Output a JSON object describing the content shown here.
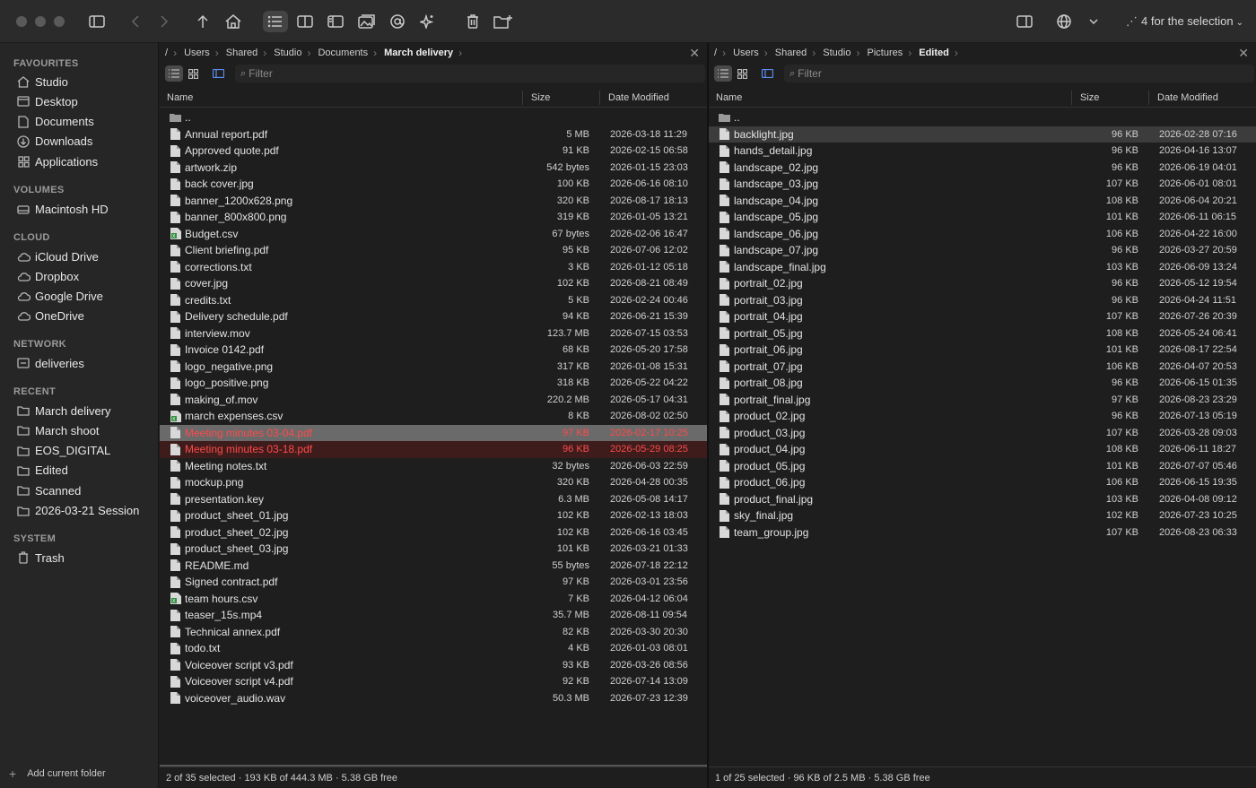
{
  "toolbar": {
    "selection_label": "4 for the selection"
  },
  "sidebar": {
    "sections": [
      {
        "title": "FAVOURITES",
        "items": [
          {
            "label": "Studio",
            "icon": "home-icon"
          },
          {
            "label": "Desktop",
            "icon": "desktop-icon"
          },
          {
            "label": "Documents",
            "icon": "document-icon"
          },
          {
            "label": "Downloads",
            "icon": "download-icon"
          },
          {
            "label": "Applications",
            "icon": "applications-icon"
          }
        ]
      },
      {
        "title": "VOLUMES",
        "items": [
          {
            "label": "Macintosh HD",
            "icon": "drive-icon"
          }
        ]
      },
      {
        "title": "CLOUD",
        "items": [
          {
            "label": "iCloud Drive",
            "icon": "cloud-icon"
          },
          {
            "label": "Dropbox",
            "icon": "cloud-icon"
          },
          {
            "label": "Google Drive",
            "icon": "cloud-icon"
          },
          {
            "label": "OneDrive",
            "icon": "cloud-icon"
          }
        ]
      },
      {
        "title": "NETWORK",
        "items": [
          {
            "label": "deliveries",
            "icon": "network-drive-icon"
          }
        ]
      },
      {
        "title": "RECENT",
        "items": [
          {
            "label": "March delivery",
            "icon": "folder-icon"
          },
          {
            "label": "March shoot",
            "icon": "folder-icon"
          },
          {
            "label": "EOS_DIGITAL",
            "icon": "folder-icon"
          },
          {
            "label": "Edited",
            "icon": "folder-icon"
          },
          {
            "label": "Scanned",
            "icon": "folder-icon"
          },
          {
            "label": "2026-03-21 Session",
            "icon": "folder-icon"
          }
        ]
      },
      {
        "title": "SYSTEM",
        "items": [
          {
            "label": "Trash",
            "icon": "trash-icon"
          }
        ]
      }
    ],
    "footer": "Add current folder"
  },
  "left_pane": {
    "breadcrumb": [
      "/",
      "Users",
      "Shared",
      "Studio",
      "Documents",
      "March delivery"
    ],
    "filter_placeholder": "Filter",
    "columns": {
      "name": "Name",
      "size": "Size",
      "date": "Date Modified"
    },
    "files": [
      {
        "name": "..",
        "size": "",
        "date": "",
        "type": "folder"
      },
      {
        "name": "Annual report.pdf",
        "size": "5 MB",
        "date": "2026-03-18 11:29",
        "type": "file"
      },
      {
        "name": "Approved quote.pdf",
        "size": "91 KB",
        "date": "2026-02-15 06:58",
        "type": "file"
      },
      {
        "name": "artwork.zip",
        "size": "542 bytes",
        "date": "2026-01-15 23:03",
        "type": "file"
      },
      {
        "name": "back cover.jpg",
        "size": "100 KB",
        "date": "2026-06-16 08:10",
        "type": "file"
      },
      {
        "name": "banner_1200x628.png",
        "size": "320 KB",
        "date": "2026-08-17 18:13",
        "type": "file"
      },
      {
        "name": "banner_800x800.png",
        "size": "319 KB",
        "date": "2026-01-05 13:21",
        "type": "file"
      },
      {
        "name": "Budget.csv",
        "size": "67 bytes",
        "date": "2026-02-06 16:47",
        "type": "sheet"
      },
      {
        "name": "Client briefing.pdf",
        "size": "95 KB",
        "date": "2026-07-06 12:02",
        "type": "file"
      },
      {
        "name": "corrections.txt",
        "size": "3 KB",
        "date": "2026-01-12 05:18",
        "type": "file"
      },
      {
        "name": "cover.jpg",
        "size": "102 KB",
        "date": "2026-08-21 08:49",
        "type": "file"
      },
      {
        "name": "credits.txt",
        "size": "5 KB",
        "date": "2026-02-24 00:46",
        "type": "file"
      },
      {
        "name": "Delivery schedule.pdf",
        "size": "94 KB",
        "date": "2026-06-21 15:39",
        "type": "file"
      },
      {
        "name": "interview.mov",
        "size": "123.7 MB",
        "date": "2026-07-15 03:53",
        "type": "file"
      },
      {
        "name": "Invoice 0142.pdf",
        "size": "68 KB",
        "date": "2026-05-20 17:58",
        "type": "file"
      },
      {
        "name": "logo_negative.png",
        "size": "317 KB",
        "date": "2026-01-08 15:31",
        "type": "file"
      },
      {
        "name": "logo_positive.png",
        "size": "318 KB",
        "date": "2026-05-22 04:22",
        "type": "file"
      },
      {
        "name": "making_of.mov",
        "size": "220.2 MB",
        "date": "2026-05-17 04:31",
        "type": "file"
      },
      {
        "name": "march expenses.csv",
        "size": "8 KB",
        "date": "2026-08-02 02:50",
        "type": "sheet"
      },
      {
        "name": "Meeting minutes 03-04.pdf",
        "size": "97 KB",
        "date": "2026-02-17 10:25",
        "type": "file",
        "state": "focus"
      },
      {
        "name": "Meeting minutes 03-18.pdf",
        "size": "96 KB",
        "date": "2026-05-29 08:25",
        "type": "file",
        "state": "marked"
      },
      {
        "name": "Meeting notes.txt",
        "size": "32 bytes",
        "date": "2026-06-03 22:59",
        "type": "file"
      },
      {
        "name": "mockup.png",
        "size": "320 KB",
        "date": "2026-04-28 00:35",
        "type": "file"
      },
      {
        "name": "presentation.key",
        "size": "6.3 MB",
        "date": "2026-05-08 14:17",
        "type": "file"
      },
      {
        "name": "product_sheet_01.jpg",
        "size": "102 KB",
        "date": "2026-02-13 18:03",
        "type": "file"
      },
      {
        "name": "product_sheet_02.jpg",
        "size": "102 KB",
        "date": "2026-06-16 03:45",
        "type": "file"
      },
      {
        "name": "product_sheet_03.jpg",
        "size": "101 KB",
        "date": "2026-03-21 01:33",
        "type": "file"
      },
      {
        "name": "README.md",
        "size": "55 bytes",
        "date": "2026-07-18 22:12",
        "type": "file"
      },
      {
        "name": "Signed contract.pdf",
        "size": "97 KB",
        "date": "2026-03-01 23:56",
        "type": "file"
      },
      {
        "name": "team hours.csv",
        "size": "7 KB",
        "date": "2026-04-12 06:04",
        "type": "sheet"
      },
      {
        "name": "teaser_15s.mp4",
        "size": "35.7 MB",
        "date": "2026-08-11 09:54",
        "type": "file"
      },
      {
        "name": "Technical annex.pdf",
        "size": "82 KB",
        "date": "2026-03-30 20:30",
        "type": "file"
      },
      {
        "name": "todo.txt",
        "size": "4 KB",
        "date": "2026-01-03 08:01",
        "type": "file"
      },
      {
        "name": "Voiceover script v3.pdf",
        "size": "93 KB",
        "date": "2026-03-26 08:56",
        "type": "file"
      },
      {
        "name": "Voiceover script v4.pdf",
        "size": "92 KB",
        "date": "2026-07-14 13:09",
        "type": "file"
      },
      {
        "name": "voiceover_audio.wav",
        "size": "50.3 MB",
        "date": "2026-07-23 12:39",
        "type": "file"
      }
    ],
    "status": "2 of 35 selected · 193 KB of 444.3 MB · 5.38 GB free"
  },
  "right_pane": {
    "breadcrumb": [
      "/",
      "Users",
      "Shared",
      "Studio",
      "Pictures",
      "Edited"
    ],
    "filter_placeholder": "Filter",
    "columns": {
      "name": "Name",
      "size": "Size",
      "date": "Date Modified"
    },
    "files": [
      {
        "name": "..",
        "size": "",
        "date": "",
        "type": "folder"
      },
      {
        "name": "backlight.jpg",
        "size": "96 KB",
        "date": "2026-02-28 07:16",
        "type": "file",
        "state": "hl"
      },
      {
        "name": "hands_detail.jpg",
        "size": "96 KB",
        "date": "2026-04-16 13:07",
        "type": "file"
      },
      {
        "name": "landscape_02.jpg",
        "size": "96 KB",
        "date": "2026-06-19 04:01",
        "type": "file"
      },
      {
        "name": "landscape_03.jpg",
        "size": "107 KB",
        "date": "2026-06-01 08:01",
        "type": "file"
      },
      {
        "name": "landscape_04.jpg",
        "size": "108 KB",
        "date": "2026-06-04 20:21",
        "type": "file"
      },
      {
        "name": "landscape_05.jpg",
        "size": "101 KB",
        "date": "2026-06-11 06:15",
        "type": "file"
      },
      {
        "name": "landscape_06.jpg",
        "size": "106 KB",
        "date": "2026-04-22 16:00",
        "type": "file"
      },
      {
        "name": "landscape_07.jpg",
        "size": "96 KB",
        "date": "2026-03-27 20:59",
        "type": "file"
      },
      {
        "name": "landscape_final.jpg",
        "size": "103 KB",
        "date": "2026-06-09 13:24",
        "type": "file"
      },
      {
        "name": "portrait_02.jpg",
        "size": "96 KB",
        "date": "2026-05-12 19:54",
        "type": "file"
      },
      {
        "name": "portrait_03.jpg",
        "size": "96 KB",
        "date": "2026-04-24 11:51",
        "type": "file"
      },
      {
        "name": "portrait_04.jpg",
        "size": "107 KB",
        "date": "2026-07-26 20:39",
        "type": "file"
      },
      {
        "name": "portrait_05.jpg",
        "size": "108 KB",
        "date": "2026-05-24 06:41",
        "type": "file"
      },
      {
        "name": "portrait_06.jpg",
        "size": "101 KB",
        "date": "2026-08-17 22:54",
        "type": "file"
      },
      {
        "name": "portrait_07.jpg",
        "size": "106 KB",
        "date": "2026-04-07 20:53",
        "type": "file"
      },
      {
        "name": "portrait_08.jpg",
        "size": "96 KB",
        "date": "2026-06-15 01:35",
        "type": "file"
      },
      {
        "name": "portrait_final.jpg",
        "size": "97 KB",
        "date": "2026-08-23 23:29",
        "type": "file"
      },
      {
        "name": "product_02.jpg",
        "size": "96 KB",
        "date": "2026-07-13 05:19",
        "type": "file"
      },
      {
        "name": "product_03.jpg",
        "size": "107 KB",
        "date": "2026-03-28 09:03",
        "type": "file"
      },
      {
        "name": "product_04.jpg",
        "size": "108 KB",
        "date": "2026-06-11 18:27",
        "type": "file"
      },
      {
        "name": "product_05.jpg",
        "size": "101 KB",
        "date": "2026-07-07 05:46",
        "type": "file"
      },
      {
        "name": "product_06.jpg",
        "size": "106 KB",
        "date": "2026-06-15 19:35",
        "type": "file"
      },
      {
        "name": "product_final.jpg",
        "size": "103 KB",
        "date": "2026-04-08 09:12",
        "type": "file"
      },
      {
        "name": "sky_final.jpg",
        "size": "102 KB",
        "date": "2026-07-23 10:25",
        "type": "file"
      },
      {
        "name": "team_group.jpg",
        "size": "107 KB",
        "date": "2026-08-23 06:33",
        "type": "file"
      }
    ],
    "status": "1 of 25 selected · 96 KB of 2.5 MB · 5.38 GB free"
  },
  "colors": {
    "selection_red": "#ff4a4a",
    "focus_row": "#6a6a6a",
    "marked_row": "#3f1c1c",
    "accent_blue": "#5b8ff5"
  }
}
